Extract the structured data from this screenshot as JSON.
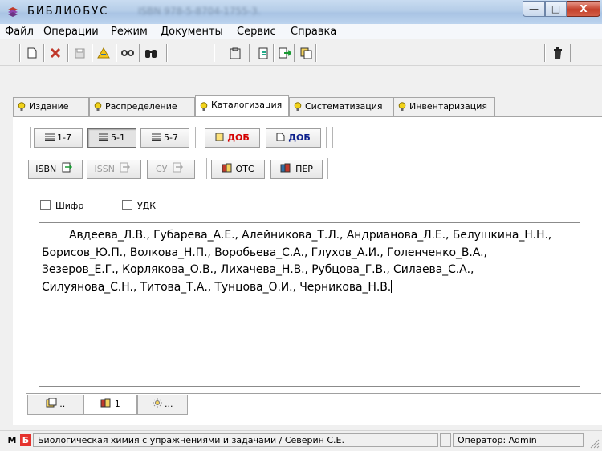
{
  "window": {
    "title": "БИБЛИОБУС",
    "title_extra": "ISBN 978-5-8704-1755-3.",
    "minimize": "—",
    "maximize": "□",
    "close": "X"
  },
  "menu": [
    "Файл",
    "Операции",
    "Режим",
    "Документы",
    "Сервис",
    "Справка"
  ],
  "tabs": [
    "Издание",
    "Распределение",
    "Каталогизация",
    "Систематизация",
    "Инвентаризация"
  ],
  "active_tab": "Каталогизация",
  "row1": {
    "b1": "1-7",
    "b2": "5-1",
    "b3": "5-7",
    "b4": "ДОБ",
    "b5": "ДОБ"
  },
  "row2": {
    "isbn": "ISBN",
    "issn": "ISSN",
    "su": "СУ",
    "ots": "ОТС",
    "per": "ПЕР"
  },
  "checks": {
    "shifr": "Шифр",
    "udk": "УДК"
  },
  "authors": {
    "line1": "Авдеева_Л.В., Губарева_А.Е., Алейникова_Т.Л., Андрианова_Л.Е., Белушкина_Н.Н.,",
    "line2": "Борисов_Ю.П., Волкова_Н.П., Воробьева_С.А., Глухов_А.И., Голенченко_В.А.,",
    "line3": "Зезеров_Е.Г., Корлякова_О.В., Лихачева_Н.В., Рубцова_Г.В., Силаева_С.А.,",
    "line4": "Силуянова_С.Н., Титова_Т.А., Тунцова_О.И., Черникова_Н.В."
  },
  "bottom_tabs": {
    "t1": "..",
    "t2": "1",
    "t3": "..."
  },
  "status": {
    "m": "М",
    "b": "Б",
    "book": "Биологическая химия с упражнениями и задачами / Северин С.Е.",
    "operator": "Оператор: Admin"
  },
  "colors": {
    "dob_red": "#d40000",
    "dob_blue": "#0a1e8c",
    "badge_red": "#e5322d",
    "accent": "#b5cde8"
  }
}
